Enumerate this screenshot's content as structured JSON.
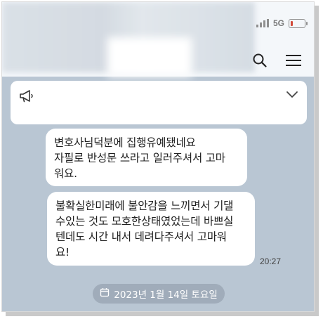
{
  "status_bar": {
    "network": "5G",
    "battery_level": 0.2,
    "battery_color": "#d24a3a"
  },
  "header": {
    "icons": [
      "search-icon",
      "menu-icon"
    ]
  },
  "notice": {
    "icons": [
      "megaphone-icon",
      "chevron-down-icon"
    ]
  },
  "messages": [
    {
      "lines": [
        "변호사님덕분에 집행유예됐네요",
        "자필로 반성문 쓰라고 일러주셔서 고마",
        "워요."
      ]
    },
    {
      "lines": [
        "불확실한미래에 불안감을 느끼면서 기댈",
        "수있는 것도 모호한상태였었는데 바쁘실",
        "텐데도 시간 내서 데려다주셔서 고마워",
        "요!"
      ],
      "time": "20:27"
    }
  ],
  "date_divider": {
    "icon": "calendar-icon",
    "label": "2023년 1월 14일 토요일"
  },
  "colors": {
    "chat_background": "#b9c6d3",
    "bubble": "#ffffff",
    "topbar": "#f4f7fa"
  }
}
